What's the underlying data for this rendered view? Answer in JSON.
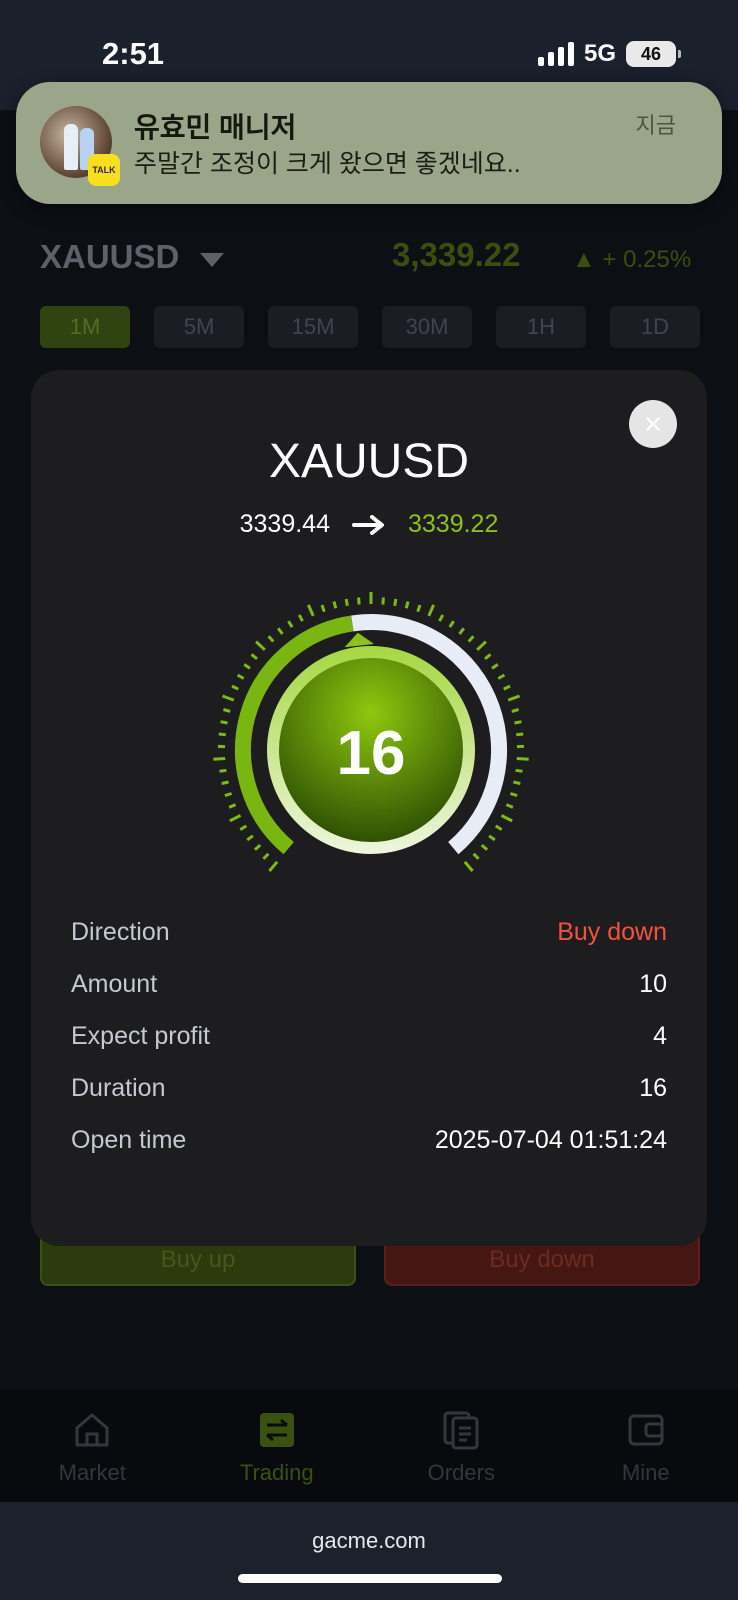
{
  "status_bar": {
    "time": "2:51",
    "network": "5G",
    "battery": "46"
  },
  "notification": {
    "app_badge": "TALK",
    "sender": "유효민 매니저",
    "message": "주말간 조정이 크게 왔으면 좋겠네요..",
    "time": "지금"
  },
  "background": {
    "symbol": "XAUUSD",
    "price": "3,339.22",
    "change": "▲ + 0.25%",
    "tabs": [
      "1M",
      "5M",
      "15M",
      "30M",
      "1H",
      "1D"
    ],
    "active_tab": "1M",
    "buy_up": "Buy up",
    "buy_down": "Buy down"
  },
  "nav": [
    {
      "label": "Market",
      "icon": "home-icon",
      "active": false
    },
    {
      "label": "Trading",
      "icon": "trading-icon",
      "active": true
    },
    {
      "label": "Orders",
      "icon": "orders-icon",
      "active": false
    },
    {
      "label": "Mine",
      "icon": "wallet-icon",
      "active": false
    }
  ],
  "browser": {
    "url": "gacme.com"
  },
  "modal": {
    "title": "XAUUSD",
    "open_price": "3339.44",
    "close_price": "3339.22",
    "countdown": "16",
    "countdown_progress": 0.47,
    "details": [
      {
        "label": "Direction",
        "value": "Buy down"
      },
      {
        "label": "Amount",
        "value": "10"
      },
      {
        "label": "Expect profit",
        "value": "4"
      },
      {
        "label": "Duration",
        "value": "16"
      },
      {
        "label": "Open time",
        "value": "2025-07-04 01:51:24"
      }
    ]
  },
  "colors": {
    "accent_green": "#8cc216",
    "direction_red": "#f0533d",
    "modal_bg": "#1d1d1f"
  }
}
